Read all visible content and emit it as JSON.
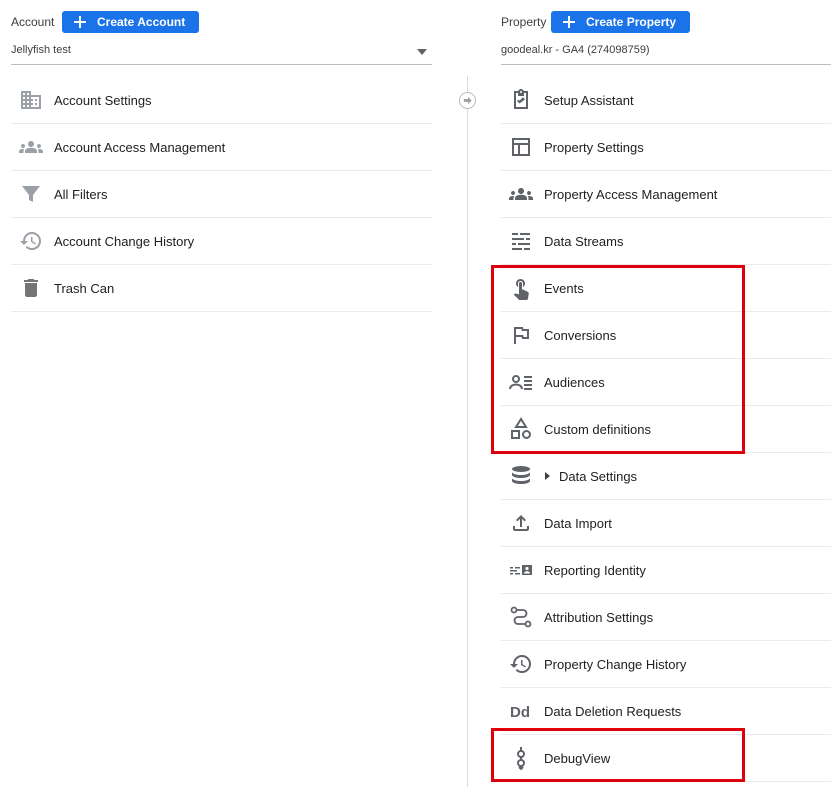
{
  "account": {
    "label": "Account",
    "create_label": "Create Account",
    "selected": "Jellyfish test",
    "items": [
      {
        "label": "Account Settings",
        "icon": "building-icon"
      },
      {
        "label": "Account Access Management",
        "icon": "people-icon"
      },
      {
        "label": "All Filters",
        "icon": "filter-icon"
      },
      {
        "label": "Account Change History",
        "icon": "history-icon"
      },
      {
        "label": "Trash Can",
        "icon": "trash-icon"
      }
    ]
  },
  "property": {
    "label": "Property",
    "create_label": "Create Property",
    "selected": "goodeal.kr - GA4 (274098759)",
    "items": [
      {
        "label": "Setup Assistant",
        "icon": "clipboard-check-icon"
      },
      {
        "label": "Property Settings",
        "icon": "layout-icon"
      },
      {
        "label": "Property Access Management",
        "icon": "people-icon"
      },
      {
        "label": "Data Streams",
        "icon": "streams-icon"
      },
      {
        "label": "Events",
        "icon": "touch-icon"
      },
      {
        "label": "Conversions",
        "icon": "flag-icon"
      },
      {
        "label": "Audiences",
        "icon": "audience-icon"
      },
      {
        "label": "Custom definitions",
        "icon": "shapes-icon"
      },
      {
        "label": "Data Settings",
        "icon": "database-icon"
      },
      {
        "label": "Data Import",
        "icon": "upload-icon"
      },
      {
        "label": "Reporting Identity",
        "icon": "identity-icon"
      },
      {
        "label": "Attribution Settings",
        "icon": "attribution-icon"
      },
      {
        "label": "Property Change History",
        "icon": "history-icon"
      },
      {
        "label": "Data Deletion Requests",
        "icon": "dd-icon"
      },
      {
        "label": "DebugView",
        "icon": "debug-icon"
      }
    ]
  },
  "colors": {
    "accent": "#1a73e8",
    "highlight": "#e0000b",
    "icon": "#5f6368"
  }
}
